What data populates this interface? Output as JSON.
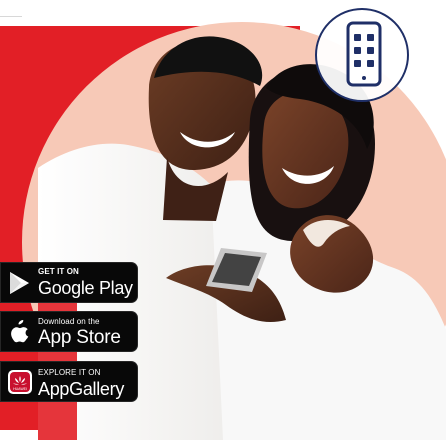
{
  "promo": {
    "colors": {
      "primary_red": "#e21f26",
      "peach_background": "#f7c9b7",
      "navy_outline": "#1f2f67",
      "store_button_black": "#080808",
      "white": "#ffffff"
    },
    "images": {
      "main_photo": "smiling couple looking at smartphone",
      "badge_icon": "mobile-phone-app-grid-icon"
    },
    "buttons": {
      "google_play": {
        "small": "GET IT ON",
        "label": "Google Play",
        "icon": "google-play-icon"
      },
      "app_store": {
        "small": "Download on the",
        "label": "App Store",
        "icon": "apple-icon"
      },
      "app_gallery": {
        "small": "EXPLORE IT ON",
        "label": "AppGallery",
        "icon": "huawei-icon"
      }
    }
  }
}
